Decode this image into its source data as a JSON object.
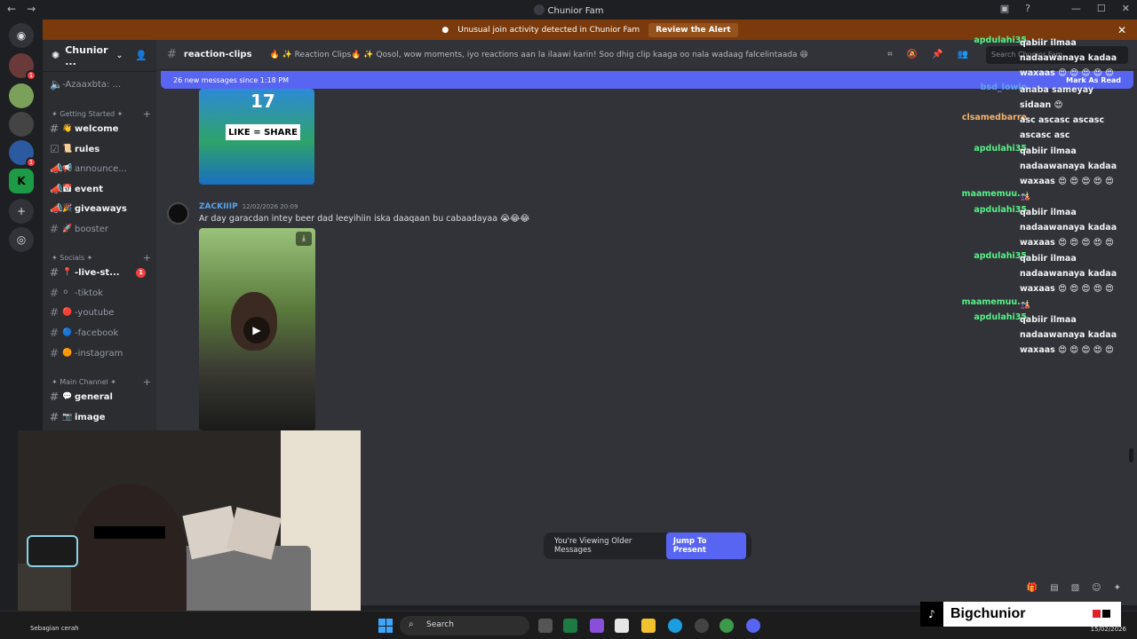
{
  "window": {
    "title": "Chunior Fam"
  },
  "alert": {
    "text": "Unusual join activity detected in Chunior Fam",
    "button": "Review the Alert"
  },
  "guild": {
    "name": "Chunior ..."
  },
  "sidebar": {
    "top_channel": "-Azaaxbta: ...",
    "categories": [
      {
        "label": "✦ Getting Started ✦"
      },
      {
        "label": "✦ Socials ✦"
      },
      {
        "label": "✦ Main Channel ✦"
      }
    ],
    "channels": [
      {
        "emoji": "👋",
        "label": "welcome"
      },
      {
        "emoji": "📜",
        "label": "rules"
      },
      {
        "emoji": "📢",
        "label": "announce..."
      },
      {
        "emoji": "📅",
        "label": "event"
      },
      {
        "emoji": "🎉",
        "label": "giveaways"
      },
      {
        "emoji": "🚀",
        "label": "booster"
      },
      {
        "emoji": "📍",
        "label": "-live-st...",
        "badge": "1"
      },
      {
        "emoji": "⚪",
        "label": "-tiktok"
      },
      {
        "emoji": "🔴",
        "label": "-youtube"
      },
      {
        "emoji": "🔵",
        "label": "-facebook"
      },
      {
        "emoji": "🟠",
        "label": "-instagram"
      },
      {
        "emoji": "💬",
        "label": "general"
      },
      {
        "emoji": "📷",
        "label": "image"
      }
    ]
  },
  "topbar": {
    "channel": "reaction-clips",
    "topic": "🔥 ✨ Reaction Clips🔥 ✨ Qosol, wow moments, iyo reactions aan la ilaawi karin! Soo dhig clip kaaga oo nala wadaag falcelintaada 😆",
    "search_placeholder": "Search Chunior Fam"
  },
  "newbar": {
    "text": "26 new messages since 1:18 PM",
    "mark": "Mark As Read"
  },
  "thumb": {
    "number": "17",
    "caption": "LIKE = SHARE"
  },
  "message": {
    "user": "ZACKIIIP",
    "timestamp": "12/02/2026 20:09",
    "text": "Ar day garacdan intey beer dad leeyihiin iska daaqaan bu cabaadayaa 😭😂😂"
  },
  "older": {
    "text": "You're Viewing Older Messages",
    "button": "Jump To Present"
  },
  "live_chat": [
    {
      "name": "apdulahi35",
      "color": "#57f287",
      "text": "qabiir ilmaa nadaawanaya kadaa waxaas 😍 😍 😍 😍 😍"
    },
    {
      "name": "bsd_lowio",
      "color": "#5ba3e8",
      "text": "anaba sameyay sidaan 😍"
    },
    {
      "name": "clsamedbarre",
      "color": "#f5b26b",
      "text": "asc ascasc ascasc ascasc asc"
    },
    {
      "name": "apdulahi35",
      "color": "#57f287",
      "text": "qabiir ilmaa nadaawanaya kadaa waxaas 😍 😍 😍 😍 😍"
    },
    {
      "name": "maamemuu...",
      "color": "#57f287",
      "text": "🎎"
    },
    {
      "name": "apdulahi35",
      "color": "#57f287",
      "text": "qabiir ilmaa nadaawanaya kadaa waxaas 😍 😍 😍 😍 😍"
    },
    {
      "name": "apdulahi35",
      "color": "#57f287",
      "text": "qabiir ilmaa nadaawanaya kadaa waxaas 😍 😍 😍 😍 😍"
    },
    {
      "name": "maamemuu...",
      "color": "#57f287",
      "text": "🎎"
    },
    {
      "name": "apdulahi35",
      "color": "#57f287",
      "text": "qabiir ilmaa nadaawanaya kadaa waxaas 😍 😍 😍 😍 😍"
    }
  ],
  "taskbar": {
    "weather": "Sebagian cerah",
    "search": "Search",
    "date": "15/02/2026"
  },
  "tiktok": {
    "handle": "Bigchunior"
  }
}
